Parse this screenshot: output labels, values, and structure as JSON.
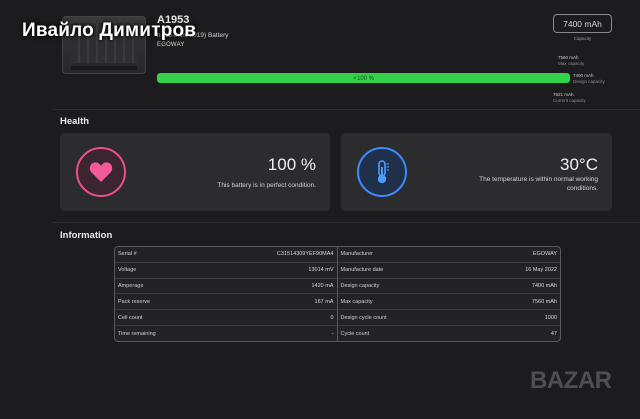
{
  "watermark": {
    "text": "Ивайло Димитров"
  },
  "battery": {
    "model": "A1953",
    "description": "h (15-inch, 2019) Battery",
    "manufacturer": "EGOWAY",
    "capacity_value": "7400 mAh",
    "capacity_caption": "Capacity",
    "charge_label": "⚡100 %",
    "charge_fraction": 1.0,
    "charge_color": "#33d24a",
    "markers": {
      "max_value": "7560 mAh",
      "max_caption": "Max capacity",
      "design_value": "7400 mAh",
      "design_caption": "Design capacity",
      "current_value": "7621 mAh",
      "current_caption": "Current capacity"
    }
  },
  "health": {
    "section_title": "Health",
    "condition": {
      "icon": "heart-icon",
      "value": "100 %",
      "text": "This battery is in perfect condition.",
      "accent": "#ec4f8c"
    },
    "temperature": {
      "icon": "thermometer-icon",
      "value": "30°C",
      "text": "The temperature is within normal working conditions.",
      "accent": "#3a8dff"
    }
  },
  "information": {
    "section_title": "Information",
    "left": [
      {
        "label": "Serial #",
        "value": "C31514309YEF90MA4"
      },
      {
        "label": "Voltage",
        "value": "13014 mV"
      },
      {
        "label": "Amperage",
        "value": "1420 mA"
      },
      {
        "label": "Pack reserve",
        "value": "167 mA"
      },
      {
        "label": "Cell count",
        "value": "0"
      },
      {
        "label": "Time remaining",
        "value": "-"
      }
    ],
    "right": [
      {
        "label": "Manufacturer",
        "value": "EGOWAY"
      },
      {
        "label": "Manufacture date",
        "value": "16 May 2022"
      },
      {
        "label": "Design capacity",
        "value": "7400 mAh"
      },
      {
        "label": "Max capacity",
        "value": "7560 mAh"
      },
      {
        "label": "Design cycle count",
        "value": "1000"
      },
      {
        "label": "Cycle count",
        "value": "47"
      }
    ]
  },
  "logo": {
    "text": "BAZAR"
  }
}
